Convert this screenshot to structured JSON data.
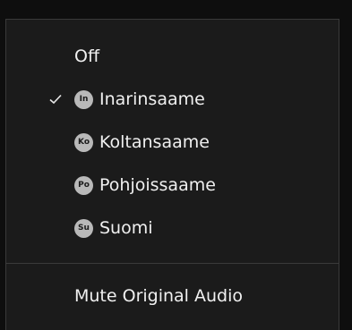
{
  "menu": {
    "off_label": "Off",
    "languages": [
      {
        "label": "Inarinsaame",
        "badge": "In",
        "selected": true
      },
      {
        "label": "Koltansaame",
        "badge": "Ko",
        "selected": false
      },
      {
        "label": "Pohjoissaame",
        "badge": "Po",
        "selected": false
      },
      {
        "label": "Suomi",
        "badge": "Su",
        "selected": false
      }
    ],
    "mute_label": "Mute Original Audio"
  },
  "colors": {
    "background": "#1b1b1b",
    "text": "#f0f0f0",
    "badge": "#b9b9b9",
    "divider": "#3a3a3a"
  },
  "icons": {
    "selected": "check-icon"
  }
}
